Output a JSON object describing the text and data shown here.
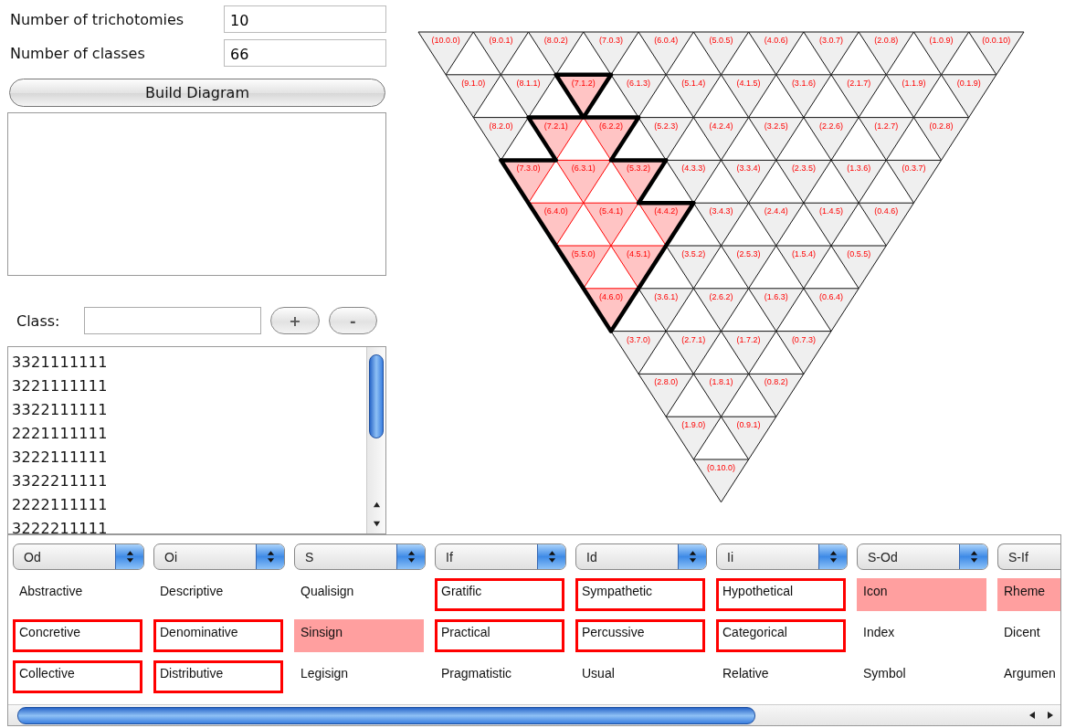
{
  "form": {
    "fields": [
      {
        "label": "Number of trichotomies",
        "value": "10"
      },
      {
        "label": "Number of classes",
        "value": "66"
      }
    ],
    "build_button": "Build Diagram"
  },
  "class_entry": {
    "label": "Class:",
    "add_button": "+",
    "remove_button": "-"
  },
  "class_list": {
    "items": [
      "3321111111",
      "3221111111",
      "3322111111",
      "2221111111",
      "3222111111",
      "3322211111",
      "2222111111",
      "3222211111"
    ]
  },
  "triangle": {
    "rows": [
      {
        "cells": [
          {
            "label": "(10.0.0)",
            "selected": false
          },
          {
            "label": "(9.0.1)",
            "selected": false
          },
          {
            "label": "(8.0.2)",
            "selected": false
          },
          {
            "label": "(7.0.3)",
            "selected": false
          },
          {
            "label": "(6.0.4)",
            "selected": false
          },
          {
            "label": "(5.0.5)",
            "selected": false
          },
          {
            "label": "(4.0.6)",
            "selected": false
          },
          {
            "label": "(3.0.7)",
            "selected": false
          },
          {
            "label": "(2.0.8)",
            "selected": false
          },
          {
            "label": "(1.0.9)",
            "selected": false
          },
          {
            "label": "(0.0.10)",
            "selected": false
          }
        ]
      },
      {
        "cells": [
          {
            "label": "(9.1.0)",
            "selected": false
          },
          {
            "label": "(8.1.1)",
            "selected": false
          },
          {
            "label": "(7.1.2)",
            "selected": true
          },
          {
            "label": "(6.1.3)",
            "selected": false
          },
          {
            "label": "(5.1.4)",
            "selected": false
          },
          {
            "label": "(4.1.5)",
            "selected": false
          },
          {
            "label": "(3.1.6)",
            "selected": false
          },
          {
            "label": "(2.1.7)",
            "selected": false
          },
          {
            "label": "(1.1.9)",
            "selected": false
          },
          {
            "label": "(0.1.9)",
            "selected": false
          }
        ]
      },
      {
        "cells": [
          {
            "label": "(8.2.0)",
            "selected": false
          },
          {
            "label": "(7.2.1)",
            "selected": true
          },
          {
            "label": "(6.2.2)",
            "selected": true
          },
          {
            "label": "(5.2.3)",
            "selected": false
          },
          {
            "label": "(4.2.4)",
            "selected": false
          },
          {
            "label": "(3.2.5)",
            "selected": false
          },
          {
            "label": "(2.2.6)",
            "selected": false
          },
          {
            "label": "(1.2.7)",
            "selected": false
          },
          {
            "label": "(0.2.8)",
            "selected": false
          }
        ]
      },
      {
        "cells": [
          {
            "label": "(7.3.0)",
            "selected": true
          },
          {
            "label": "(6.3.1)",
            "selected": true
          },
          {
            "label": "(5.3.2)",
            "selected": true
          },
          {
            "label": "(4.3.3)",
            "selected": false
          },
          {
            "label": "(3.3.4)",
            "selected": false
          },
          {
            "label": "(2.3.5)",
            "selected": false
          },
          {
            "label": "(1.3.6)",
            "selected": false
          },
          {
            "label": "(0.3.7)",
            "selected": false
          }
        ]
      },
      {
        "cells": [
          {
            "label": "(6.4.0)",
            "selected": true
          },
          {
            "label": "(5.4.1)",
            "selected": true
          },
          {
            "label": "(4.4.2)",
            "selected": true
          },
          {
            "label": "(3.4.3)",
            "selected": false
          },
          {
            "label": "(2.4.4)",
            "selected": false
          },
          {
            "label": "(1.4.5)",
            "selected": false
          },
          {
            "label": "(0.4.6)",
            "selected": false
          }
        ]
      },
      {
        "cells": [
          {
            "label": "(5.5.0)",
            "selected": true
          },
          {
            "label": "(4.5.1)",
            "selected": true
          },
          {
            "label": "(3.5.2)",
            "selected": false
          },
          {
            "label": "(2.5.3)",
            "selected": false
          },
          {
            "label": "(1.5.4)",
            "selected": false
          },
          {
            "label": "(0.5.5)",
            "selected": false
          }
        ]
      },
      {
        "cells": [
          {
            "label": "(4.6.0)",
            "selected": true
          },
          {
            "label": "(3.6.1)",
            "selected": false
          },
          {
            "label": "(2.6.2)",
            "selected": false
          },
          {
            "label": "(1.6.3)",
            "selected": false
          },
          {
            "label": "(0.6.4)",
            "selected": false
          }
        ]
      },
      {
        "cells": [
          {
            "label": "(3.7.0)",
            "selected": false
          },
          {
            "label": "(2.7.1)",
            "selected": false
          },
          {
            "label": "(1.7.2)",
            "selected": false
          },
          {
            "label": "(0.7.3)",
            "selected": false
          }
        ]
      },
      {
        "cells": [
          {
            "label": "(2.8.0)",
            "selected": false
          },
          {
            "label": "(1.8.1)",
            "selected": false
          },
          {
            "label": "(0.8.2)",
            "selected": false
          }
        ]
      },
      {
        "cells": [
          {
            "label": "(1.9.0)",
            "selected": false
          },
          {
            "label": "(0.9.1)",
            "selected": false
          }
        ]
      },
      {
        "cells": [
          {
            "label": "(0.10.0)",
            "selected": false
          }
        ]
      }
    ]
  },
  "trichotomies": {
    "columns": [
      {
        "dropdown": "Od",
        "options": [
          {
            "label": "Abstractive",
            "selected": false,
            "outlined": false
          },
          {
            "label": "Concretive",
            "selected": false,
            "outlined": true
          },
          {
            "label": "Collective",
            "selected": false,
            "outlined": true
          }
        ]
      },
      {
        "dropdown": "Oi",
        "options": [
          {
            "label": "Descriptive",
            "selected": false,
            "outlined": false
          },
          {
            "label": "Denominative",
            "selected": false,
            "outlined": true
          },
          {
            "label": "Distributive",
            "selected": false,
            "outlined": true
          }
        ]
      },
      {
        "dropdown": "S",
        "options": [
          {
            "label": "Qualisign",
            "selected": false,
            "outlined": false
          },
          {
            "label": "Sinsign",
            "selected": true,
            "outlined": false
          },
          {
            "label": "Legisign",
            "selected": false,
            "outlined": false
          }
        ]
      },
      {
        "dropdown": "If",
        "options": [
          {
            "label": "Gratific",
            "selected": false,
            "outlined": true
          },
          {
            "label": "Practical",
            "selected": false,
            "outlined": true
          },
          {
            "label": "Pragmatistic",
            "selected": false,
            "outlined": false
          }
        ]
      },
      {
        "dropdown": "Id",
        "options": [
          {
            "label": "Sympathetic",
            "selected": false,
            "outlined": true
          },
          {
            "label": "Percussive",
            "selected": false,
            "outlined": true
          },
          {
            "label": "Usual",
            "selected": false,
            "outlined": false
          }
        ]
      },
      {
        "dropdown": "Ii",
        "options": [
          {
            "label": "Hypothetical",
            "selected": false,
            "outlined": true
          },
          {
            "label": "Categorical",
            "selected": false,
            "outlined": true
          },
          {
            "label": "Relative",
            "selected": false,
            "outlined": false
          }
        ]
      },
      {
        "dropdown": "S-Od",
        "options": [
          {
            "label": "Icon",
            "selected": true,
            "outlined": false
          },
          {
            "label": "Index",
            "selected": false,
            "outlined": false
          },
          {
            "label": "Symbol",
            "selected": false,
            "outlined": false
          }
        ]
      },
      {
        "dropdown": "S-If",
        "options": [
          {
            "label": "Rheme",
            "selected": true,
            "outlined": false
          },
          {
            "label": "Dicent",
            "selected": false,
            "outlined": false
          },
          {
            "label": "Argumen",
            "selected": false,
            "outlined": false
          }
        ]
      }
    ]
  }
}
